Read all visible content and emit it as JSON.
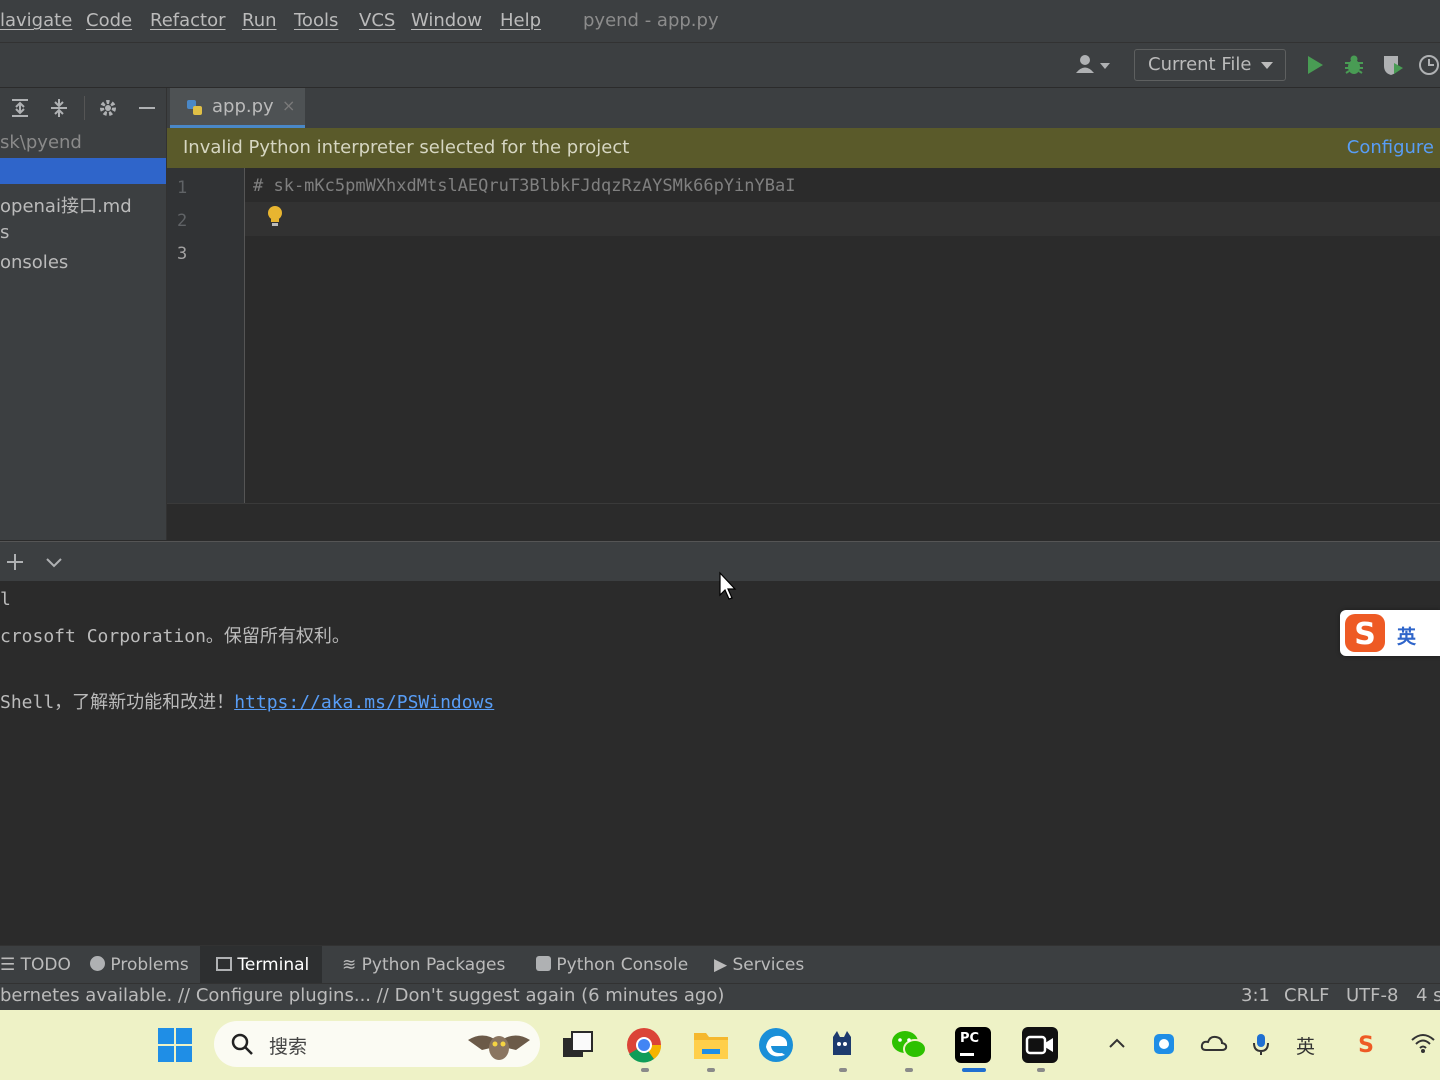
{
  "menu": {
    "items": [
      "lavigate",
      "Code",
      "Refactor",
      "Run",
      "Tools",
      "VCS",
      "Window",
      "Help"
    ],
    "window_title": "pyend - app.py"
  },
  "toolbar": {
    "run_config": "Current File",
    "icons": [
      "user-icon",
      "run-icon",
      "debug-icon",
      "coverage-icon",
      "profile-icon"
    ]
  },
  "project": {
    "path": "sk\\pyend",
    "tree": [
      "openai接口.md",
      "s",
      "onsoles"
    ]
  },
  "editor": {
    "tab_name": "app.py",
    "tab_close": "×",
    "banner_message": "Invalid Python interpreter selected for the project",
    "banner_action": "Configure",
    "line_numbers": [
      "1",
      "2",
      "3"
    ],
    "code_line_1": "# 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"
  },
  "terminal": {
    "lines": [
      "l",
      "crosoft Corporation。保留所有权利。",
      "",
      "Shell，了解新功能和改进！"
    ],
    "link": "https://aka.ms/PSWindows",
    "ime_label": "英"
  },
  "tool_tabs": {
    "todo": "TODO",
    "problems": "Problems",
    "terminal": "Terminal",
    "python_packages": "Python Packages",
    "python_console": "Python Console",
    "services": "Services"
  },
  "status": {
    "message": "bernetes available. // Configure plugins... // Don't suggest again (6 minutes ago)",
    "position": "3:1",
    "line_sep": "CRLF",
    "encoding": "UTF-8",
    "indent": "4 s"
  },
  "taskbar": {
    "search_placeholder": "搜索",
    "tray_ime": "英",
    "pycharm_label": "PC"
  }
}
